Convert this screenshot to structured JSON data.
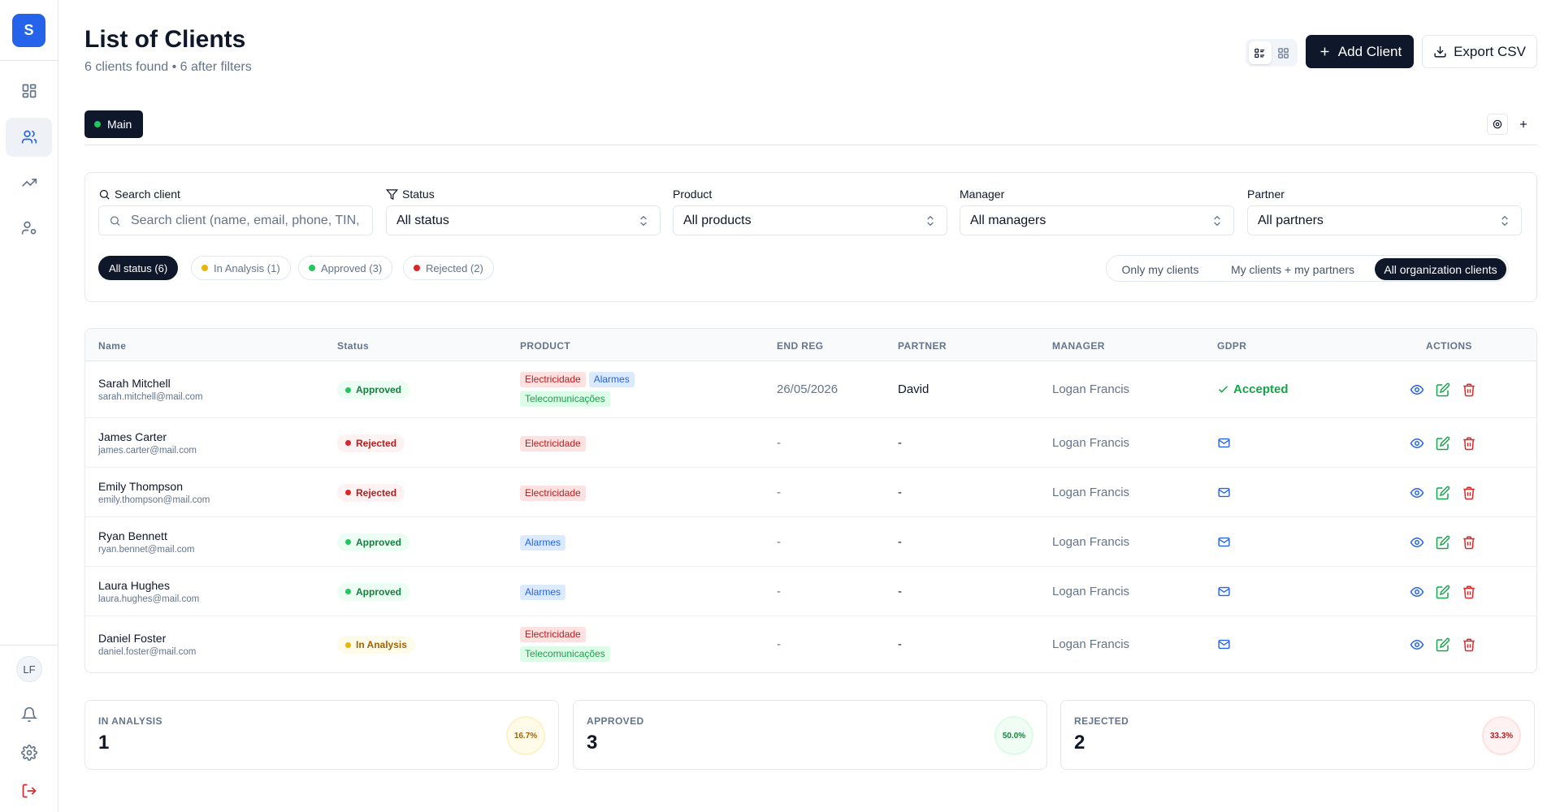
{
  "sidebar": {
    "logo_letter": "S",
    "avatar_initials": "LF",
    "items": [
      {
        "icon": "dashboard-icon"
      },
      {
        "icon": "users-icon",
        "active": true
      },
      {
        "icon": "trending-up-icon"
      },
      {
        "icon": "user-cog-icon"
      }
    ],
    "bottom": [
      {
        "icon": "bell-icon"
      },
      {
        "icon": "gear-icon"
      },
      {
        "icon": "logout-icon"
      }
    ]
  },
  "header": {
    "title": "List of Clients",
    "subtitle": "6 clients found • 6 after filters",
    "add_label": "Add Client",
    "export_label": "Export CSV"
  },
  "tabs": {
    "main_label": "Main"
  },
  "filters": {
    "search_label": "Search client",
    "search_placeholder": "Search client (name, email, phone, TIN, ...)",
    "status_label": "Status",
    "status_value": "All status",
    "product_label": "Product",
    "product_value": "All products",
    "manager_label": "Manager",
    "manager_value": "All managers",
    "partner_label": "Partner",
    "partner_value": "All partners",
    "chips": [
      {
        "label": "All status (6)",
        "active": true
      },
      {
        "label": "In Analysis (1)",
        "dot": "#eab308"
      },
      {
        "label": "Approved (3)",
        "dot": "#22c55e"
      },
      {
        "label": "Rejected (2)",
        "dot": "#dc2626"
      }
    ],
    "scope": [
      {
        "label": "Only my clients"
      },
      {
        "label": "My clients + my partners"
      },
      {
        "label": "All organization clients",
        "active": true
      }
    ]
  },
  "table": {
    "columns": [
      "Name",
      "Status",
      "PRODUCT",
      "END REG",
      "PARTNER",
      "MANAGER",
      "GDPR",
      "ACTIONS"
    ],
    "rows": [
      {
        "name": "Sarah Mitchell",
        "email": "sarah.mitchell@mail.com",
        "status": "Approved",
        "products": [
          "Electricidade",
          "Alarmes",
          "Telecomunicações"
        ],
        "end_reg": "26/05/2026",
        "partner": "David",
        "manager": "Logan Francis",
        "gdpr": "Accepted"
      },
      {
        "name": "James Carter",
        "email": "james.carter@mail.com",
        "status": "Rejected",
        "products": [
          "Electricidade"
        ],
        "end_reg": "-",
        "partner": "-",
        "manager": "Logan Francis",
        "gdpr": ""
      },
      {
        "name": "Emily Thompson",
        "email": "emily.thompson@mail.com",
        "status": "Rejected",
        "products": [
          "Electricidade"
        ],
        "end_reg": "-",
        "partner": "-",
        "manager": "Logan Francis",
        "gdpr": ""
      },
      {
        "name": "Ryan Bennett",
        "email": "ryan.bennet@mail.com",
        "status": "Approved",
        "products": [
          "Alarmes"
        ],
        "end_reg": "-",
        "partner": "-",
        "manager": "Logan Francis",
        "gdpr": ""
      },
      {
        "name": "Laura Hughes",
        "email": "laura.hughes@mail.com",
        "status": "Approved",
        "products": [
          "Alarmes"
        ],
        "end_reg": "-",
        "partner": "-",
        "manager": "Logan Francis",
        "gdpr": ""
      },
      {
        "name": "Daniel Foster",
        "email": "daniel.foster@mail.com",
        "status": "In Analysis",
        "products": [
          "Electricidade",
          "Telecomunicações"
        ],
        "end_reg": "-",
        "partner": "-",
        "manager": "Logan Francis",
        "gdpr": ""
      }
    ]
  },
  "stats": [
    {
      "label": "IN ANALYSIS",
      "value": "1",
      "percent": "16.7%",
      "color": "#a16207",
      "bg": "#fefce8"
    },
    {
      "label": "APPROVED",
      "value": "3",
      "percent": "50.0%",
      "color": "#15803d",
      "bg": "#f0fdf4"
    },
    {
      "label": "REJECTED",
      "value": "2",
      "percent": "33.3%",
      "color": "#b91c1c",
      "bg": "#fef2f2"
    }
  ],
  "colors": {
    "primary": "#0f172a",
    "accent": "#2563eb",
    "approved": "#22c55e",
    "rejected": "#dc2626",
    "analysis": "#eab308"
  }
}
